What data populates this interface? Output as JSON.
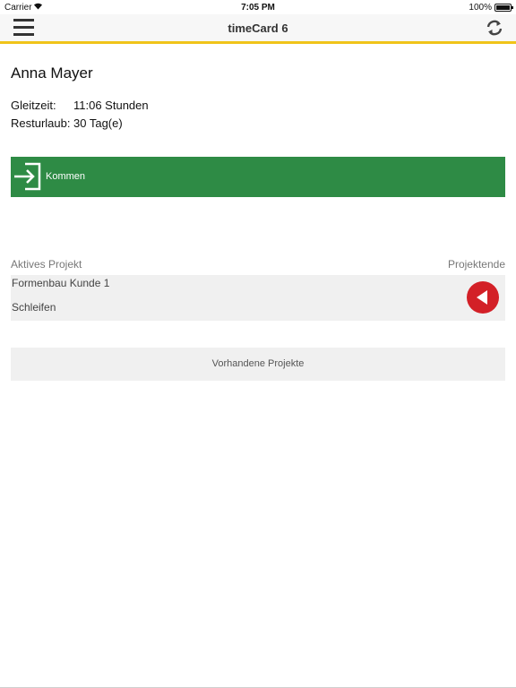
{
  "status_bar": {
    "carrier": "Carrier",
    "time": "7:05 PM",
    "battery": "100%"
  },
  "navbar": {
    "title": "timeCard 6",
    "menu_icon": "hamburger-menu-icon",
    "refresh_icon": "refresh-icon"
  },
  "user": {
    "name": "Anna Mayer",
    "flextime_label": "Gleitzeit:",
    "flextime_value": "11:06 Stunden",
    "vacation_label": "Resturlaub:",
    "vacation_value": "30 Tag(e)"
  },
  "kommen": {
    "label": "Kommen",
    "icon": "login-icon",
    "color": "#2e8b45"
  },
  "project": {
    "active_label": "Aktives Projekt",
    "end_label": "Projektende",
    "name": "Formenbau Kunde 1",
    "task": "Schleifen",
    "end_icon": "stop-back-icon",
    "end_color": "#d32027"
  },
  "existing_projects_label": "Vorhandene Projekte",
  "colors": {
    "accent": "#f0c419",
    "nav_bg": "#f7f7f7",
    "panel_bg": "#f0f0f0"
  }
}
